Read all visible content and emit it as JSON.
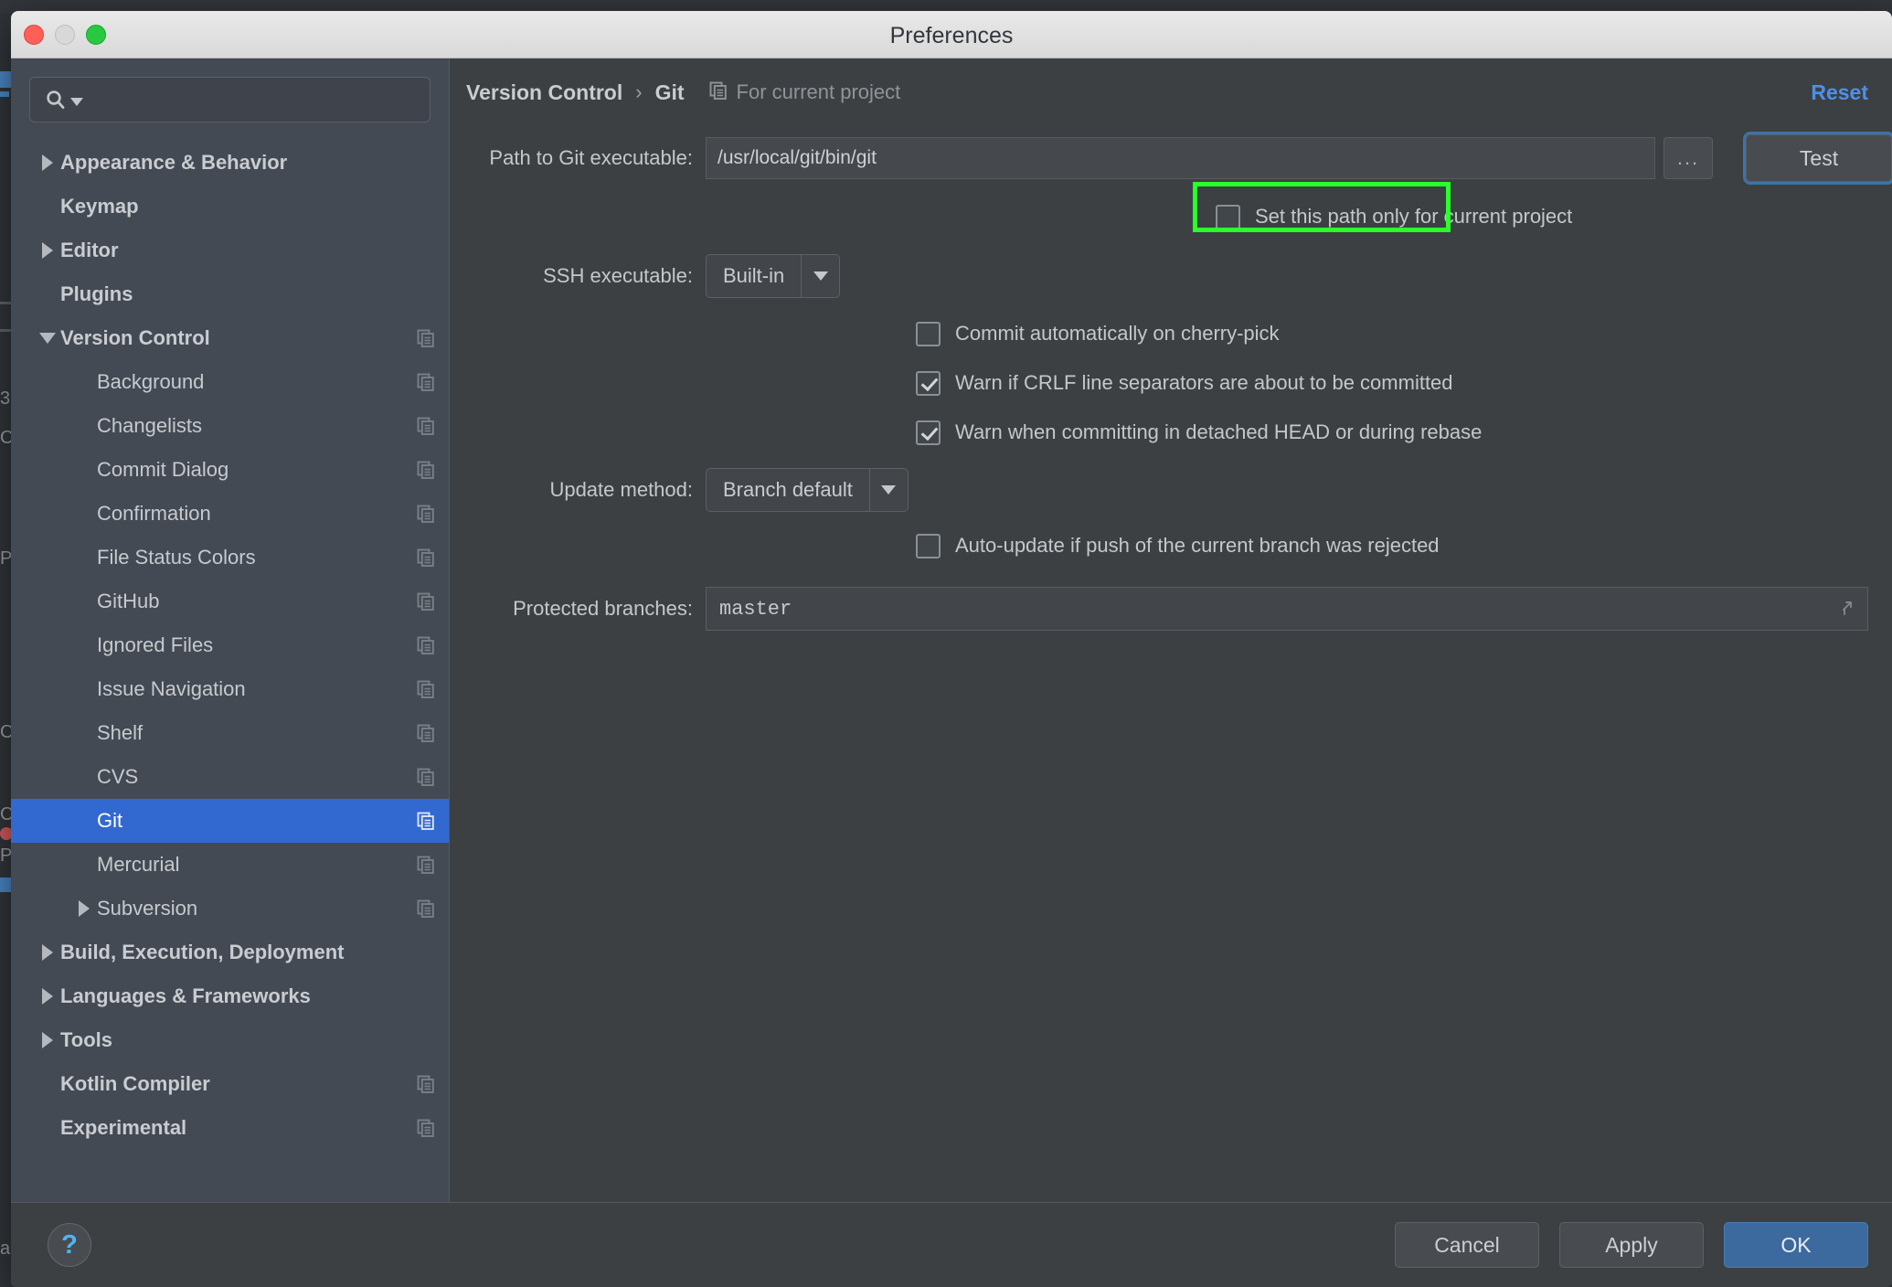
{
  "window": {
    "title": "Preferences",
    "controls": {
      "close": "close-button",
      "minimize": "minimize-button",
      "maximize": "maximize-button"
    }
  },
  "sidebar": {
    "search": {
      "value": "",
      "placeholder": ""
    },
    "items": [
      {
        "label": "Appearance & Behavior",
        "level": 0,
        "bold": true,
        "arrow": "collapsed",
        "copy": false,
        "selected": false
      },
      {
        "label": "Keymap",
        "level": 0,
        "bold": true,
        "arrow": "none",
        "copy": false,
        "selected": false
      },
      {
        "label": "Editor",
        "level": 0,
        "bold": true,
        "arrow": "collapsed",
        "copy": false,
        "selected": false
      },
      {
        "label": "Plugins",
        "level": 0,
        "bold": true,
        "arrow": "none",
        "copy": false,
        "selected": false
      },
      {
        "label": "Version Control",
        "level": 0,
        "bold": true,
        "arrow": "expanded",
        "copy": true,
        "selected": false
      },
      {
        "label": "Background",
        "level": 1,
        "bold": false,
        "arrow": "none",
        "copy": true,
        "selected": false
      },
      {
        "label": "Changelists",
        "level": 1,
        "bold": false,
        "arrow": "none",
        "copy": true,
        "selected": false
      },
      {
        "label": "Commit Dialog",
        "level": 1,
        "bold": false,
        "arrow": "none",
        "copy": true,
        "selected": false
      },
      {
        "label": "Confirmation",
        "level": 1,
        "bold": false,
        "arrow": "none",
        "copy": true,
        "selected": false
      },
      {
        "label": "File Status Colors",
        "level": 1,
        "bold": false,
        "arrow": "none",
        "copy": true,
        "selected": false
      },
      {
        "label": "GitHub",
        "level": 1,
        "bold": false,
        "arrow": "none",
        "copy": true,
        "selected": false
      },
      {
        "label": "Ignored Files",
        "level": 1,
        "bold": false,
        "arrow": "none",
        "copy": true,
        "selected": false
      },
      {
        "label": "Issue Navigation",
        "level": 1,
        "bold": false,
        "arrow": "none",
        "copy": true,
        "selected": false
      },
      {
        "label": "Shelf",
        "level": 1,
        "bold": false,
        "arrow": "none",
        "copy": true,
        "selected": false
      },
      {
        "label": "CVS",
        "level": 1,
        "bold": false,
        "arrow": "none",
        "copy": true,
        "selected": false
      },
      {
        "label": "Git",
        "level": 1,
        "bold": false,
        "arrow": "none",
        "copy": true,
        "selected": true
      },
      {
        "label": "Mercurial",
        "level": 1,
        "bold": false,
        "arrow": "none",
        "copy": true,
        "selected": false
      },
      {
        "label": "Subversion",
        "level": 1,
        "bold": false,
        "arrow": "collapsed",
        "copy": true,
        "selected": false
      },
      {
        "label": "Build, Execution, Deployment",
        "level": 0,
        "bold": true,
        "arrow": "collapsed",
        "copy": false,
        "selected": false
      },
      {
        "label": "Languages & Frameworks",
        "level": 0,
        "bold": true,
        "arrow": "collapsed",
        "copy": false,
        "selected": false
      },
      {
        "label": "Tools",
        "level": 0,
        "bold": true,
        "arrow": "collapsed",
        "copy": false,
        "selected": false
      },
      {
        "label": "Kotlin Compiler",
        "level": 0,
        "bold": true,
        "arrow": "none",
        "copy": true,
        "selected": false
      },
      {
        "label": "Experimental",
        "level": 0,
        "bold": true,
        "arrow": "none",
        "copy": true,
        "selected": false
      }
    ]
  },
  "main": {
    "breadcrumb": {
      "parent": "Version Control",
      "separator": "›",
      "current": "Git"
    },
    "scope_note": "For current project",
    "reset_label": "Reset",
    "fields": {
      "path_label": "Path to Git executable:",
      "path_value": "/usr/local/git/bin/git",
      "browse_label": "...",
      "test_label": "Test",
      "set_path_only_label": "Set this path only for current project",
      "set_path_only_checked": false,
      "ssh_label": "SSH executable:",
      "ssh_value": "Built-in",
      "commit_auto_label": "Commit automatically on cherry-pick",
      "commit_auto_checked": false,
      "warn_crlf_label": "Warn if CRLF line separators are about to be committed",
      "warn_crlf_checked": true,
      "warn_detached_label": "Warn when committing in detached HEAD or during rebase",
      "warn_detached_checked": true,
      "update_method_label": "Update method:",
      "update_method_value": "Branch default",
      "auto_update_label": "Auto-update if push of the current branch was rejected",
      "auto_update_checked": false,
      "protected_label": "Protected branches:",
      "protected_value": "master"
    }
  },
  "footer": {
    "help_label": "?",
    "cancel_label": "Cancel",
    "apply_label": "Apply",
    "ok_label": "OK"
  },
  "annotation": {
    "color": "#2bff2b",
    "target": "path-to-git-executable-input"
  },
  "colors": {
    "sidebar_bg": "#434a54",
    "main_bg": "#3c4043",
    "selection_blue": "#3169d0",
    "link_blue": "#4d90e8",
    "primary_button": "#3c6a9e",
    "highlight_green": "#2bff2b"
  },
  "backdrop_text": {
    "a": "3",
    "b": "C",
    "c": "P",
    "d": "C",
    "e": "C",
    "f": "P",
    "g": "a"
  }
}
